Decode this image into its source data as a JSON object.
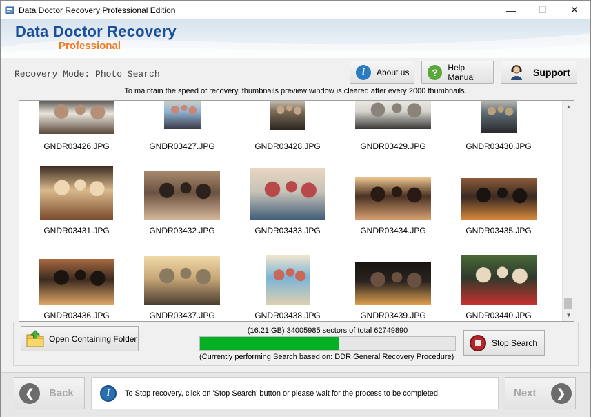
{
  "window": {
    "title": "Data Doctor Recovery Professional Edition",
    "minimize_glyph": "—",
    "maximize_glyph": "☐",
    "close_glyph": "✕"
  },
  "brand": {
    "name": "Data Doctor Recovery",
    "edition": "Professional"
  },
  "header": {
    "mode_label": "Recovery Mode: Photo Search",
    "about_label": "About us",
    "help_label": "Help Manual",
    "support_label": "Support"
  },
  "notice": "To maintain the speed of recovery, thumbnails preview window is cleared after every 2000 thumbnails.",
  "thumbnails": [
    {
      "name": "GNDR03426.JPG",
      "palette": [
        "#e9e4dc",
        "#5a4a3c",
        "#b49078",
        "#2e2a28"
      ]
    },
    {
      "name": "GNDR03427.JPG",
      "palette": [
        "#8fb6d4",
        "#3b3a4a",
        "#c98676",
        "#e4d8c4"
      ]
    },
    {
      "name": "GNDR03428.JPG",
      "palette": [
        "#7a6a56",
        "#2c2622",
        "#c4a486",
        "#e2dbcf"
      ]
    },
    {
      "name": "GNDR03429.JPG",
      "palette": [
        "#d7d4ce",
        "#3a3836",
        "#8a837a",
        "#f0efec"
      ]
    },
    {
      "name": "GNDR03430.JPG",
      "palette": [
        "#5c6b74",
        "#2b2a2e",
        "#b9a07e",
        "#d8cfc4"
      ]
    },
    {
      "name": "GNDR03431.JPG",
      "palette": [
        "#d9b98c",
        "#7a4a2c",
        "#f0d7b4",
        "#3a2a20"
      ]
    },
    {
      "name": "GNDR03432.JPG",
      "palette": [
        "#6b5140",
        "#d6b79a",
        "#2c221c",
        "#a88a6e"
      ]
    },
    {
      "name": "GNDR03433.JPG",
      "palette": [
        "#c8c2b8",
        "#3e5c78",
        "#b8484a",
        "#e8d6c0"
      ]
    },
    {
      "name": "GNDR03434.JPG",
      "palette": [
        "#4a3224",
        "#d8a070",
        "#2a1a14",
        "#f0c890"
      ]
    },
    {
      "name": "GNDR03435.JPG",
      "palette": [
        "#3a2a22",
        "#d88a3c",
        "#1a1410",
        "#8a5a3a"
      ]
    },
    {
      "name": "GNDR03436.JPG",
      "palette": [
        "#3c2a20",
        "#e0a868",
        "#1c140e",
        "#a86a40"
      ]
    },
    {
      "name": "GNDR03437.JPG",
      "palette": [
        "#c8a878",
        "#4a3c30",
        "#8a7a60",
        "#f0d8a8"
      ]
    },
    {
      "name": "GNDR03438.JPG",
      "palette": [
        "#7ab4d8",
        "#e0cfb0",
        "#c86858",
        "#f4e6cc"
      ]
    },
    {
      "name": "GNDR03439.JPG",
      "palette": [
        "#2a2420",
        "#e0a050",
        "#6a5040",
        "#1a1410"
      ]
    },
    {
      "name": "GNDR03440.JPG",
      "palette": [
        "#2e3a2a",
        "#c83030",
        "#e8d8c0",
        "#4a6a3a"
      ]
    }
  ],
  "controls": {
    "open_folder_label": "Open Containing Folder",
    "sectors_text": "(16.21 GB) 34005985  sectors  of  total 62749890",
    "progress_fraction": 0.542,
    "procedure_text": "(Currently performing Search based on:  DDR General Recovery Procedure)",
    "stop_label": "Stop Search"
  },
  "footer": {
    "back_label": "Back",
    "next_label": "Next",
    "info_message": "To Stop recovery, click on 'Stop Search' button or please wait for the process to be completed."
  },
  "colors": {
    "brand_blue": "#1b4f9a",
    "brand_orange": "#f47920",
    "progress_green": "#06b025"
  }
}
